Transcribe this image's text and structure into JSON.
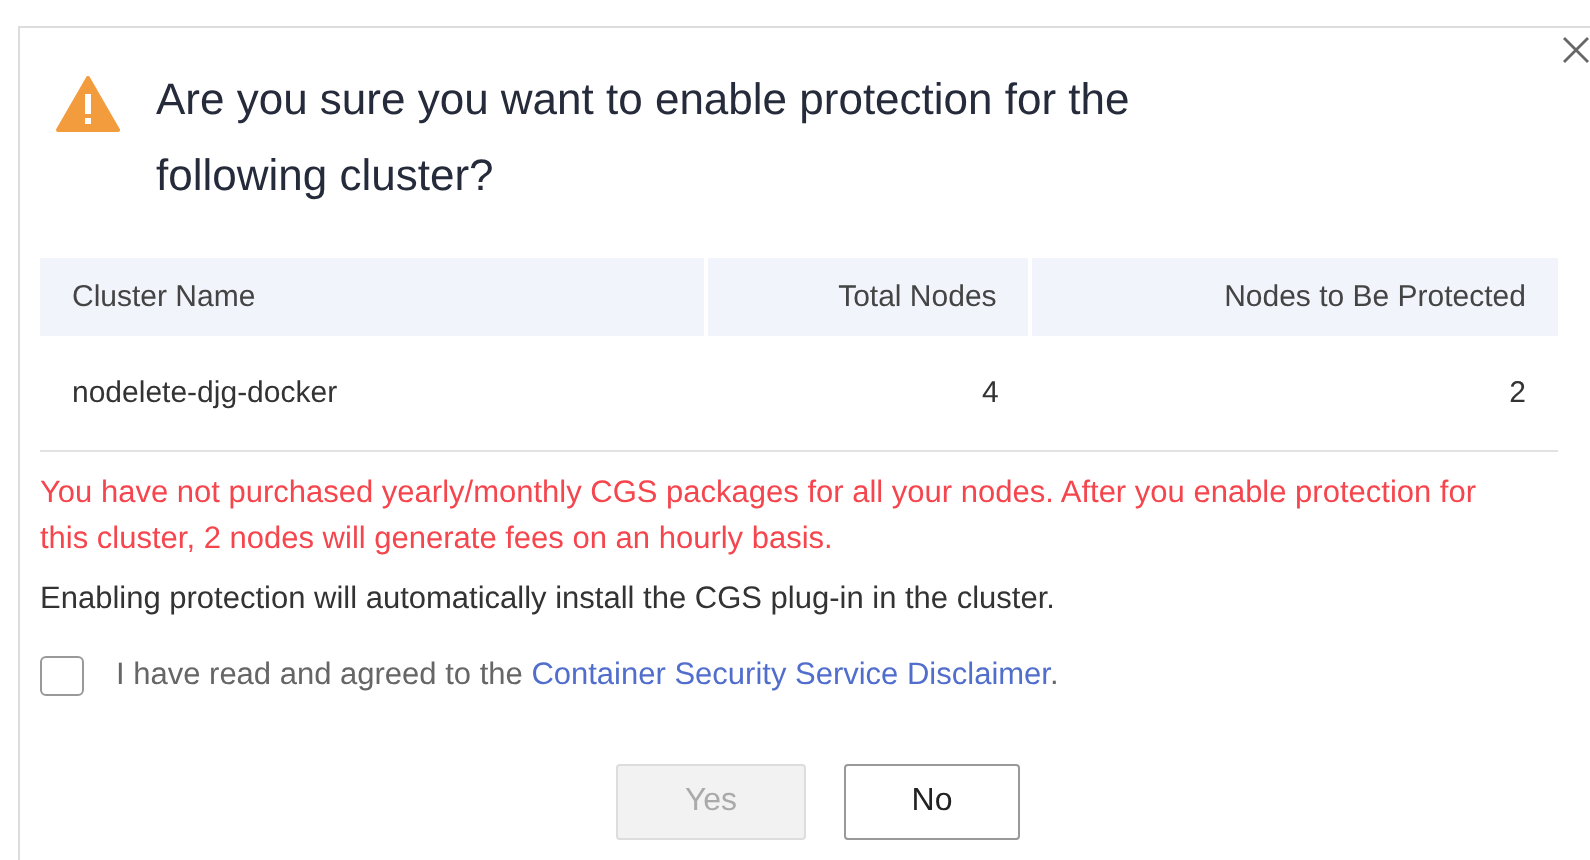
{
  "dialog": {
    "title": "Are you sure you want to enable protection for the following cluster?",
    "table": {
      "columns": [
        {
          "label": "Cluster Name"
        },
        {
          "label": "Total Nodes"
        },
        {
          "label": "Nodes to Be Protected"
        }
      ],
      "rows": [
        {
          "cells": [
            "nodelete-djg-docker",
            "4",
            "2"
          ]
        }
      ]
    },
    "warning": "You have not purchased yearly/monthly CGS packages for all your nodes. After you enable protection for this cluster, 2 nodes will generate fees on an hourly basis.",
    "note": "Enabling protection will automatically install the CGS plug-in in the cluster.",
    "agreement": {
      "checked": false,
      "text_before": "I have read and agreed to the ",
      "link": "Container Security Service Disclaimer",
      "text_after": "."
    },
    "buttons": [
      {
        "label": "Yes",
        "disabled": true
      },
      {
        "label": "No",
        "disabled": false
      }
    ]
  }
}
